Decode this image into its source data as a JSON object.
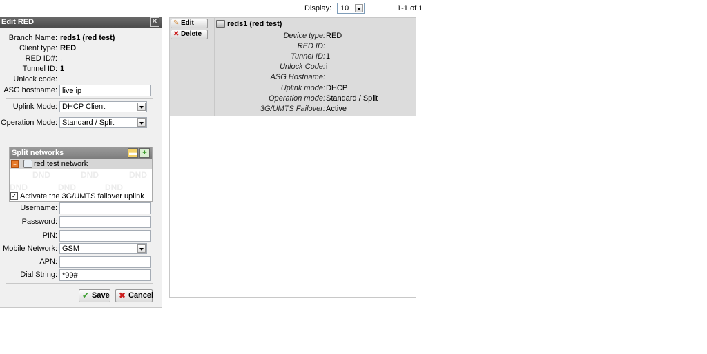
{
  "pager": {
    "display_label": "Display:",
    "display_value": "10",
    "count": "1-1 of 1"
  },
  "edit_panel": {
    "title": "Edit RED",
    "close_label": "✕",
    "branch_name_label": "Branch Name:",
    "branch_name_value": "reds1 (red test)",
    "client_type_label": "Client type:",
    "client_type_value": "RED",
    "red_id_label": "RED ID#:",
    "red_id_value": ".",
    "tunnel_id_label": "Tunnel ID:",
    "tunnel_id_value": "1",
    "unlock_code_label": "Unlock code:",
    "unlock_code_value": "",
    "asg_hostname_label": "ASG hostname:",
    "asg_hostname_value": "live ip",
    "uplink_mode_label": "Uplink Mode:",
    "uplink_mode_value": "DHCP Client",
    "operation_mode_label": "Operation Mode:",
    "operation_mode_value": "Standard / Split",
    "split_networks_title": "Split networks",
    "split_networks": [
      {
        "label": "red test network"
      }
    ],
    "dnd_watermark": "DND",
    "failover_checkbox_label": "Activate the 3G/UMTS failover uplink",
    "failover_checked": true,
    "username_label": "Username:",
    "username_value": "",
    "password_label": "Password:",
    "password_value": "",
    "pin_label": "PIN:",
    "pin_value": "",
    "mobile_network_label": "Mobile Network:",
    "mobile_network_value": "GSM",
    "apn_label": "APN:",
    "apn_value": "",
    "dial_string_label": "Dial String:",
    "dial_string_value": "*99#",
    "save_label": "Save",
    "cancel_label": "Cancel"
  },
  "device": {
    "edit_label": "Edit",
    "delete_label": "Delete",
    "title": "reds1 (red test)",
    "fields": [
      {
        "label": "Device type:",
        "value": "RED"
      },
      {
        "label": "RED ID:",
        "value": ""
      },
      {
        "label": "Tunnel ID:",
        "value": "1"
      },
      {
        "label": "Unlock Code:",
        "value": "i"
      },
      {
        "label": "ASG Hostname:",
        "value": ""
      },
      {
        "label": "Uplink mode:",
        "value": "DHCP"
      },
      {
        "label": "Operation mode:",
        "value": "Standard / Split"
      },
      {
        "label": "3G/UMTS Failover:",
        "value": "Active"
      }
    ]
  },
  "colors": {
    "panel_title_bg": "#4a4a4a",
    "panel_bg": "#f0f0f0",
    "item_row_bg": "#dcdcdc",
    "save_icon": "#3b9d2f",
    "cancel_icon": "#cc1d1d"
  }
}
